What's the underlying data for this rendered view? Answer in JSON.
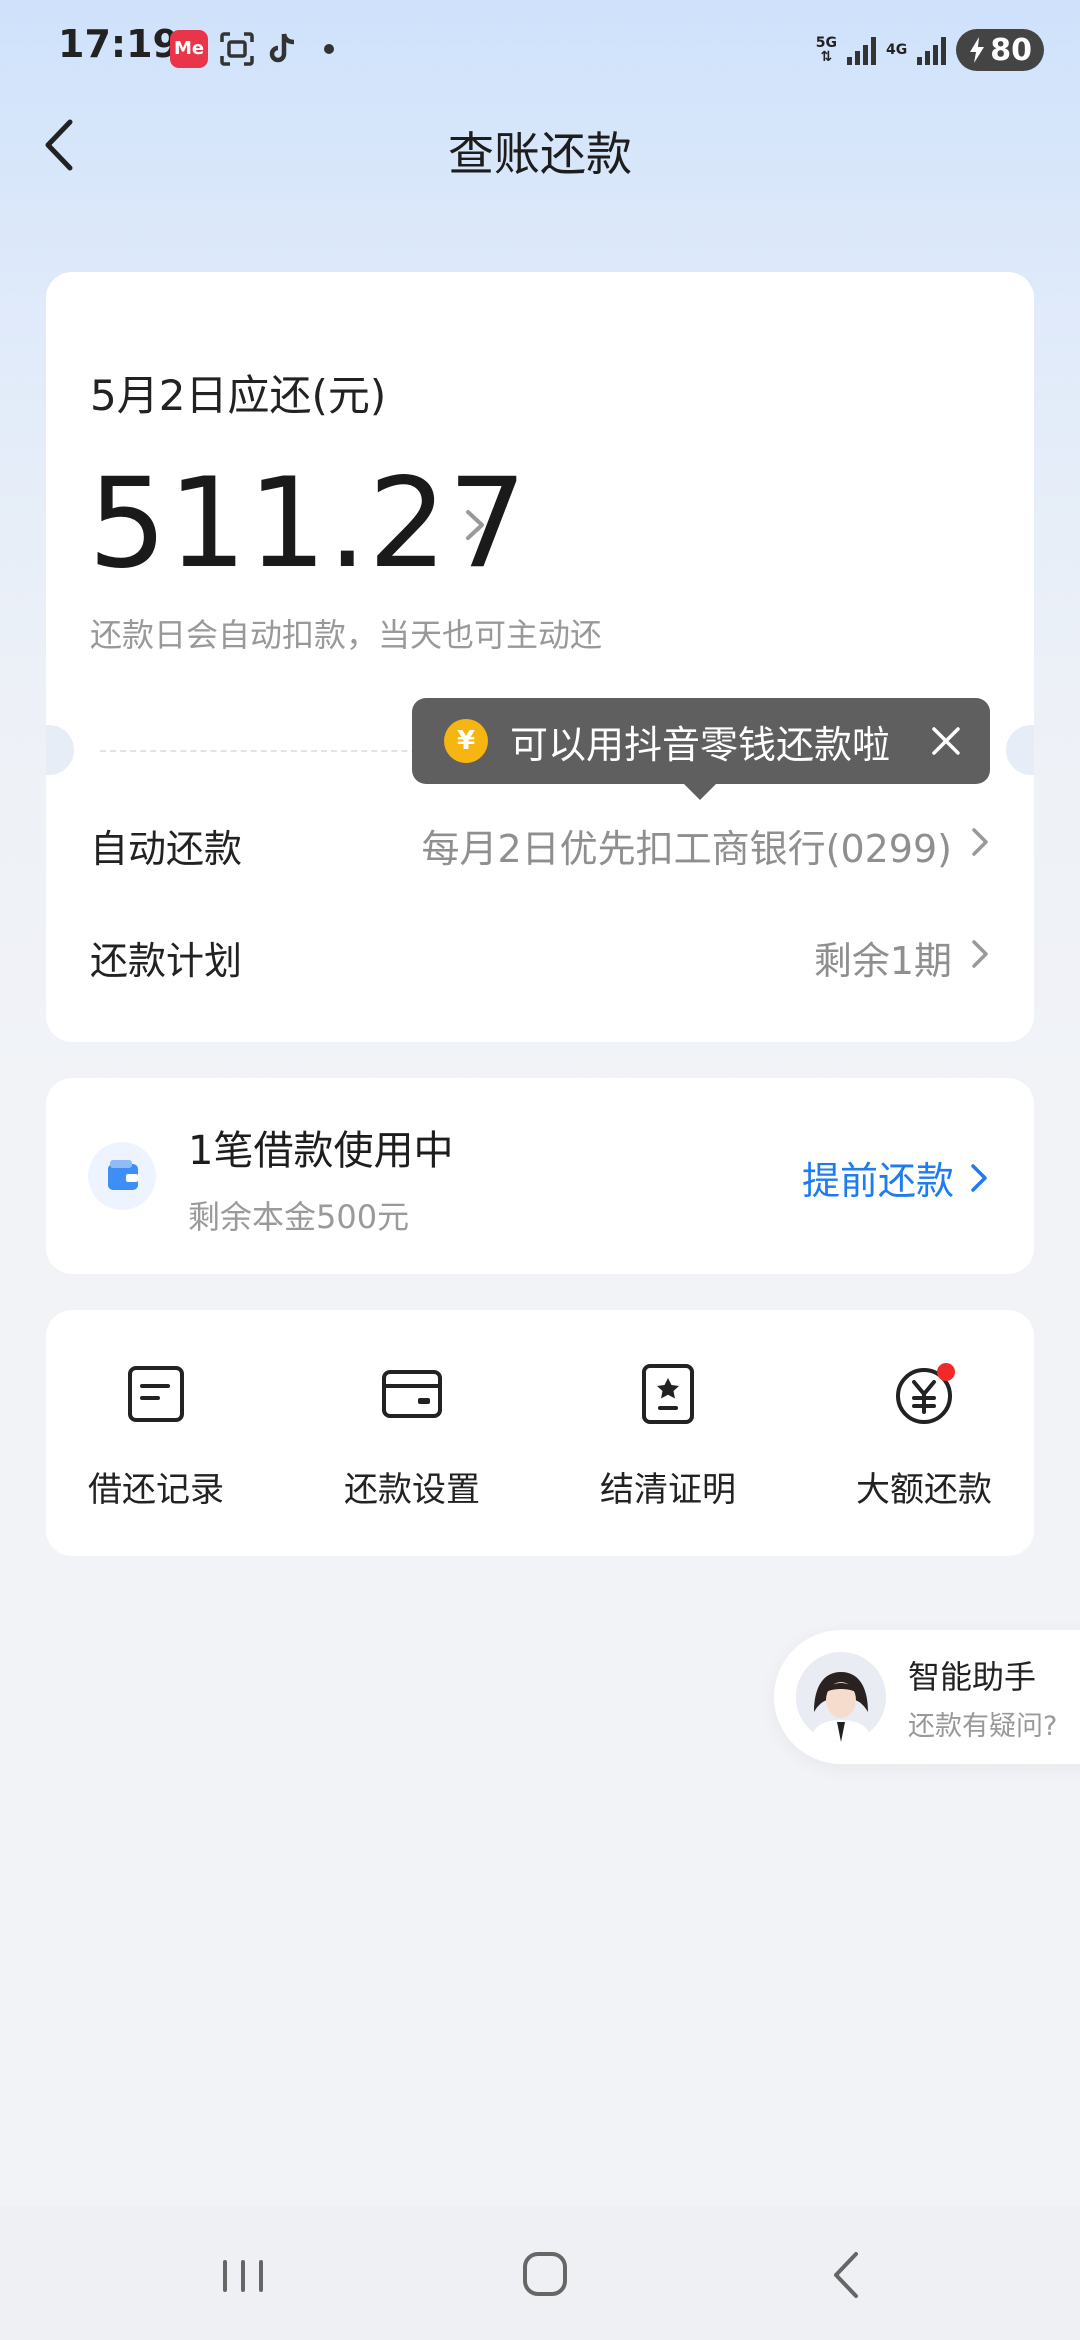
{
  "status_bar": {
    "time": "17:19",
    "app_icons": [
      "meituan-icon",
      "scan-icon",
      "tiktok-icon"
    ],
    "network": [
      "5G",
      "4G"
    ],
    "battery": "80"
  },
  "header": {
    "title": "查账还款"
  },
  "repayment": {
    "due_label": "5月2日应还(元)",
    "amount": "511.27",
    "note": "还款日会自动扣款，当天也可主动还"
  },
  "tooltip": {
    "text": "可以用抖音零钱还款啦",
    "coin": "¥"
  },
  "rows": [
    {
      "label": "自动还款",
      "value": "每月2日优先扣工商银行(0299)"
    },
    {
      "label": "还款计划",
      "value": "剩余1期"
    }
  ],
  "loan": {
    "title": "1笔借款使用中",
    "subtitle": "剩余本金500元",
    "action": "提前还款"
  },
  "grid": [
    {
      "label": "借还记录",
      "icon": "record-icon"
    },
    {
      "label": "还款设置",
      "icon": "card-icon"
    },
    {
      "label": "结清证明",
      "icon": "certificate-icon"
    },
    {
      "label": "大额还款",
      "icon": "yuan-coin-icon"
    }
  ],
  "assistant": {
    "title": "智能助手",
    "subtitle": "还款有疑问?"
  },
  "colors": {
    "accent": "#1f7bf0",
    "tooltip_bg": "#5f5f5f",
    "coin": "#f6b510",
    "badge": "#f02a2a"
  }
}
